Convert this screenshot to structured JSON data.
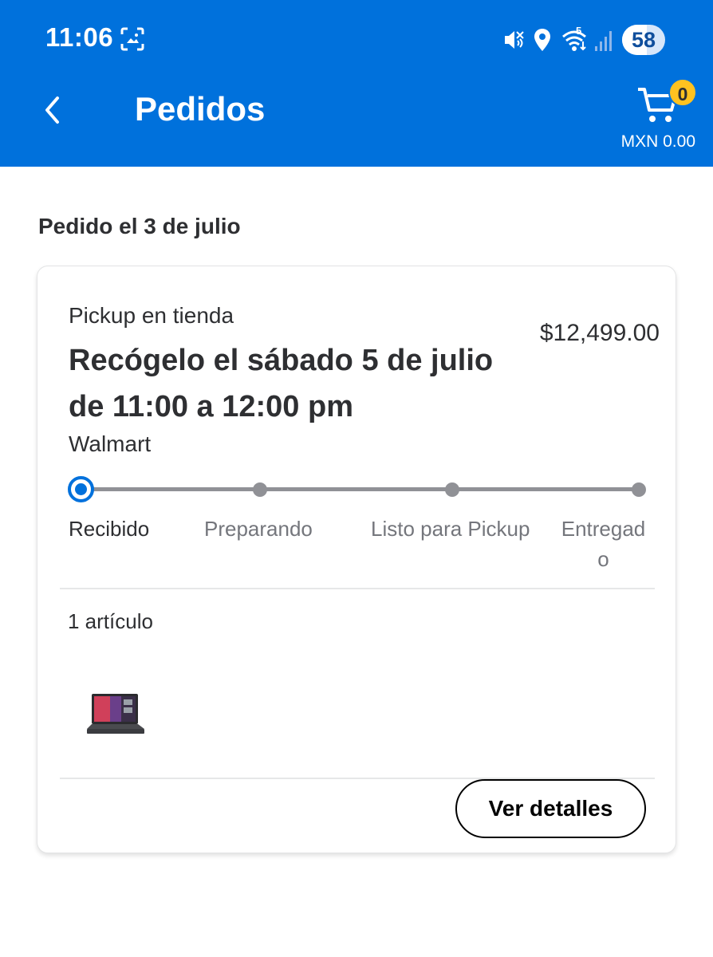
{
  "theme": {
    "brand": "#0071dc",
    "cart_badge_color": "#ffc220",
    "progress_active": "#0071dc",
    "progress_inactive": "#909196"
  },
  "status_bar": {
    "time": "11:06",
    "network_label": "5",
    "battery_level": "58",
    "battery_fraction": 0.58,
    "icons": [
      "screenshot-icon",
      "mute-icon",
      "location-icon",
      "wifi-icon",
      "signal-icon",
      "battery-icon"
    ]
  },
  "nav": {
    "title": "Pedidos",
    "cart_count": "0",
    "cart_total": "MXN 0.00",
    "icons": [
      "back-icon",
      "cart-icon"
    ]
  },
  "order": {
    "date_heading": "Pedido el 3 de julio",
    "fulfillment_type": "Pickup en tienda",
    "price": "$12,499.00",
    "pickup_window": "Recógelo el sábado 5 de julio de 11:00 a 12:00 pm",
    "store": "Walmart",
    "steps": [
      {
        "label": "Recibido",
        "active": true
      },
      {
        "label": "Preparando",
        "active": false
      },
      {
        "label": "Listo para Pickup",
        "active": false
      },
      {
        "label": "Entregad o",
        "active": false
      }
    ],
    "item_count": "1 artículo",
    "product_image": "laptop-thumbnail",
    "details_button": "Ver detalles"
  }
}
